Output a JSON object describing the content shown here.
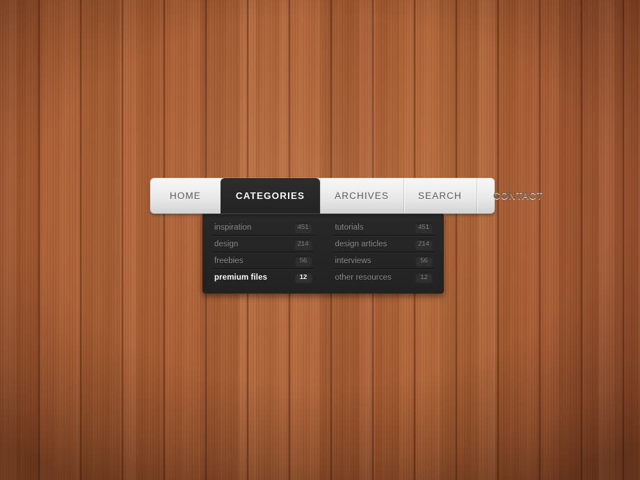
{
  "background": {
    "name": "wood-texture",
    "base_color": "#a85c31",
    "dark_edge_color": "#5e2a12"
  },
  "menu": {
    "items": [
      {
        "label": "HOME",
        "active": false
      },
      {
        "label": "CATEGORIES",
        "active": true
      },
      {
        "label": "ARCHIVES",
        "active": false
      },
      {
        "label": "SEARCH",
        "active": false
      },
      {
        "label": "CONTACT",
        "active": false
      }
    ],
    "active_color": "#ffffff",
    "inactive_color": "#57585a",
    "bar_color": "#eeeeee",
    "active_tab_color": "#282828"
  },
  "dropdown": {
    "panel_color": "#252525",
    "columns": [
      {
        "name": "left",
        "items": [
          {
            "label": "inspiration",
            "count": "451",
            "highlight": false
          },
          {
            "label": "design",
            "count": "214",
            "highlight": false
          },
          {
            "label": "freebies",
            "count": "56",
            "highlight": false
          },
          {
            "label": "premium files",
            "count": "12",
            "highlight": true
          }
        ]
      },
      {
        "name": "right",
        "items": [
          {
            "label": "tutorials",
            "count": "451",
            "highlight": false
          },
          {
            "label": "design articles",
            "count": "214",
            "highlight": false
          },
          {
            "label": "interviews",
            "count": "56",
            "highlight": false
          },
          {
            "label": "other resources",
            "count": "12",
            "highlight": false
          }
        ]
      }
    ]
  }
}
